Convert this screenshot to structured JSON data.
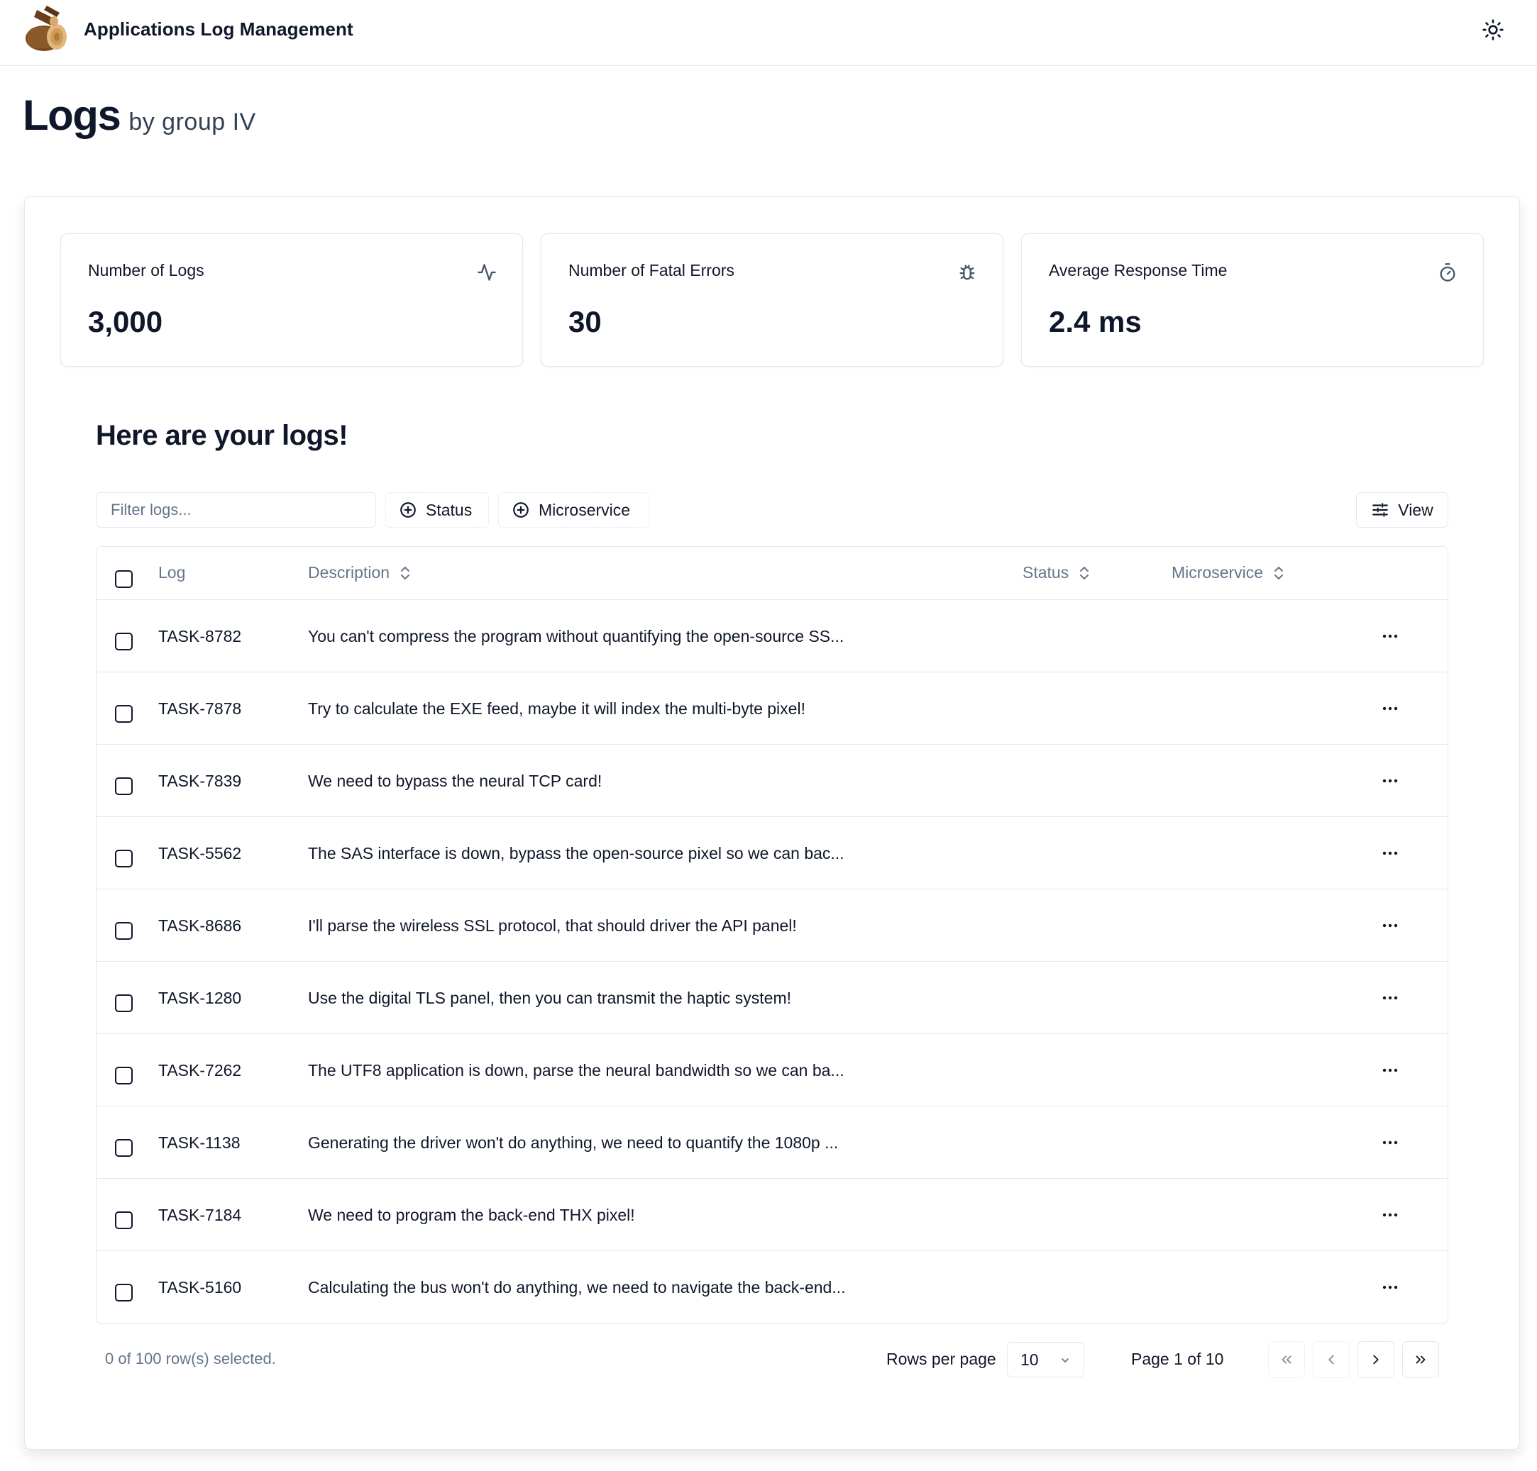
{
  "header": {
    "app_title": "Applications Log Management",
    "logo_icon": "wood-logs-logo",
    "theme_icon": "sun-icon"
  },
  "page": {
    "title": "Logs",
    "subtitle": "by group IV"
  },
  "stats": [
    {
      "label": "Number of Logs",
      "value": "3,000",
      "icon": "activity-icon"
    },
    {
      "label": "Number of Fatal Errors",
      "value": "30",
      "icon": "bug-icon"
    },
    {
      "label": "Average Response Time",
      "value": "2.4 ms",
      "icon": "timer-icon"
    }
  ],
  "section_title": "Here are your logs!",
  "toolbar": {
    "filter_placeholder": "Filter logs...",
    "status_label": "Status",
    "microservice_label": "Microservice",
    "view_label": "View"
  },
  "table": {
    "columns": {
      "log": "Log",
      "description": "Description",
      "status": "Status",
      "microservice": "Microservice"
    },
    "rows": [
      {
        "id": "TASK-8782",
        "description": "You can't compress the program without quantifying the open-source SS..."
      },
      {
        "id": "TASK-7878",
        "description": "Try to calculate the EXE feed, maybe it will index the multi-byte pixel!"
      },
      {
        "id": "TASK-7839",
        "description": "We need to bypass the neural TCP card!"
      },
      {
        "id": "TASK-5562",
        "description": "The SAS interface is down, bypass the open-source pixel so we can bac..."
      },
      {
        "id": "TASK-8686",
        "description": "I'll parse the wireless SSL protocol, that should driver the API panel!"
      },
      {
        "id": "TASK-1280",
        "description": "Use the digital TLS panel, then you can transmit the haptic system!"
      },
      {
        "id": "TASK-7262",
        "description": "The UTF8 application is down, parse the neural bandwidth so we can ba..."
      },
      {
        "id": "TASK-1138",
        "description": "Generating the driver won't do anything, we need to quantify the 1080p ..."
      },
      {
        "id": "TASK-7184",
        "description": "We need to program the back-end THX pixel!"
      },
      {
        "id": "TASK-5160",
        "description": "Calculating the bus won't do anything, we need to navigate the back-end..."
      }
    ]
  },
  "footer": {
    "selected_text": "0 of 100 row(s) selected.",
    "rows_per_page_label": "Rows per page",
    "rows_per_page_value": "10",
    "page_info": "Page 1 of 10"
  }
}
